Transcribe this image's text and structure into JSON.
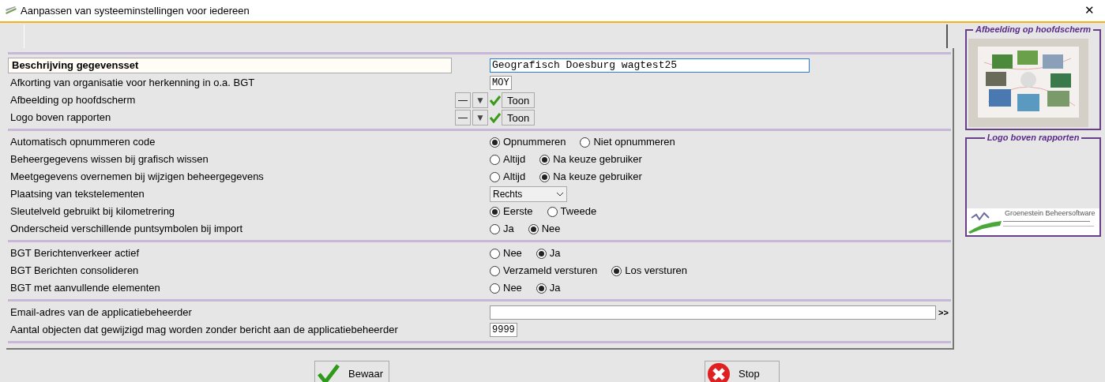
{
  "window": {
    "title": "Aanpassen van systeeminstellingen voor iedereen",
    "close": "✕"
  },
  "sections": [
    {
      "rows": [
        {
          "kind": "text_field",
          "label": "Beschrijving gegevensset",
          "value": "Geografisch Doesburg wagtest25",
          "focused": true
        },
        {
          "kind": "short_field",
          "label": "Afkorting van organisatie voor herkenning in o.a. BGT",
          "value": "MOY"
        },
        {
          "kind": "image_setting",
          "label": "Afbeelding op hoofdscherm",
          "remove": "—",
          "pick": "▼",
          "present": true,
          "show": "Toon"
        },
        {
          "kind": "image_setting",
          "label": "Logo boven rapporten",
          "remove": "—",
          "pick": "▼",
          "present": true,
          "show": "Toon"
        }
      ]
    },
    {
      "rows": [
        {
          "kind": "radio",
          "label": "Automatisch opnummeren code",
          "options": [
            {
              "label": "Opnummeren",
              "selected": true
            },
            {
              "label": "Niet opnummeren",
              "selected": false
            }
          ]
        },
        {
          "kind": "radio",
          "label": "Beheergegevens wissen bij grafisch wissen",
          "options": [
            {
              "label": "Altijd",
              "selected": false
            },
            {
              "label": "Na keuze gebruiker",
              "selected": true
            }
          ]
        },
        {
          "kind": "radio",
          "label": "Meetgegevens overnemen bij wijzigen beheergegevens",
          "options": [
            {
              "label": "Altijd",
              "selected": false
            },
            {
              "label": "Na keuze gebruiker",
              "selected": true
            }
          ]
        },
        {
          "kind": "select",
          "label": "Plaatsing van tekstelementen",
          "value": "Rechts"
        },
        {
          "kind": "radio",
          "label": "Sleutelveld gebruikt bij kilometrering",
          "options": [
            {
              "label": "Eerste",
              "selected": true
            },
            {
              "label": "Tweede",
              "selected": false
            }
          ]
        },
        {
          "kind": "radio",
          "label": "Onderscheid verschillende puntsymbolen bij import",
          "options": [
            {
              "label": "Ja",
              "selected": false
            },
            {
              "label": "Nee",
              "selected": true
            }
          ]
        }
      ]
    },
    {
      "rows": [
        {
          "kind": "radio",
          "label": "BGT Berichtenverkeer actief",
          "options": [
            {
              "label": "Nee",
              "selected": false
            },
            {
              "label": "Ja",
              "selected": true
            }
          ]
        },
        {
          "kind": "radio",
          "label": "BGT Berichten consolideren",
          "options": [
            {
              "label": "Verzameld versturen",
              "selected": false
            },
            {
              "label": "Los versturen",
              "selected": true
            }
          ]
        },
        {
          "kind": "radio",
          "label": "BGT met aanvullende elementen",
          "options": [
            {
              "label": "Nee",
              "selected": false
            },
            {
              "label": "Ja",
              "selected": true
            }
          ]
        }
      ]
    },
    {
      "rows": [
        {
          "kind": "long_field",
          "label": "Email-adres van de applicatiebeheerder",
          "value": "",
          "more": ">>"
        },
        {
          "kind": "short_field",
          "label": "Aantal objecten dat gewijzigd mag worden zonder bericht aan de applicatiebeheerder",
          "value": "9999"
        }
      ]
    }
  ],
  "previews": [
    {
      "title": "Afbeelding op hoofdscherm",
      "kind": "picture"
    },
    {
      "title": "Logo boven rapporten",
      "kind": "logo",
      "logo_text": "Groenestein Beheersoftware"
    }
  ],
  "buttons": [
    {
      "label": "Bewaar",
      "kind": "save"
    },
    {
      "label": "Stop",
      "kind": "stop"
    }
  ]
}
